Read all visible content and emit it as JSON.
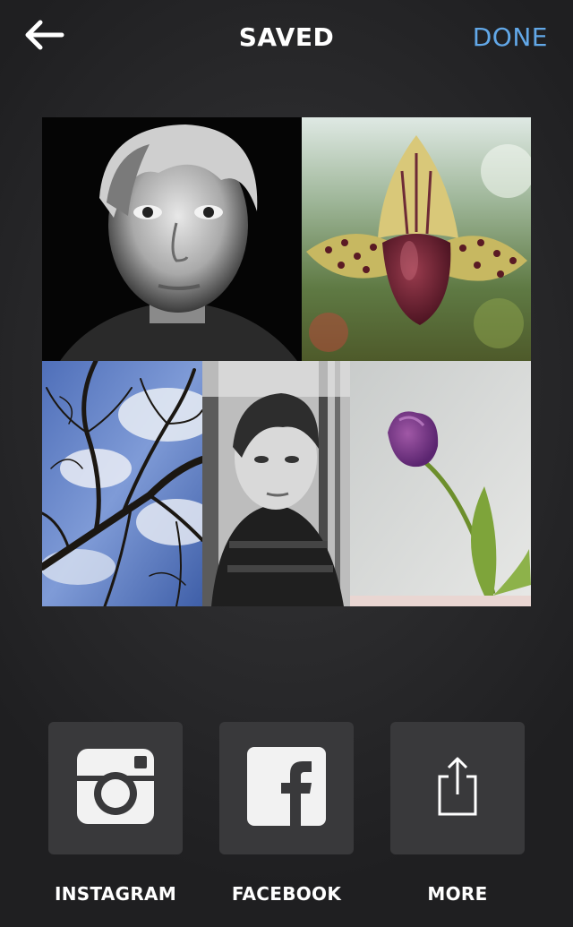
{
  "header": {
    "title": "SAVED",
    "done_label": "DONE"
  },
  "collage": {
    "photos": [
      {
        "subject": "black-and-white portrait"
      },
      {
        "subject": "orchid flower"
      },
      {
        "subject": "bare tree branches against blue sky"
      },
      {
        "subject": "black-and-white portrait outdoors"
      },
      {
        "subject": "purple tulip"
      }
    ]
  },
  "share": {
    "instagram_label": "INSTAGRAM",
    "facebook_label": "FACEBOOK",
    "more_label": "MORE"
  },
  "colors": {
    "accent": "#62a8e8",
    "button_bg": "#39393b",
    "background": "#2c2c2e"
  }
}
